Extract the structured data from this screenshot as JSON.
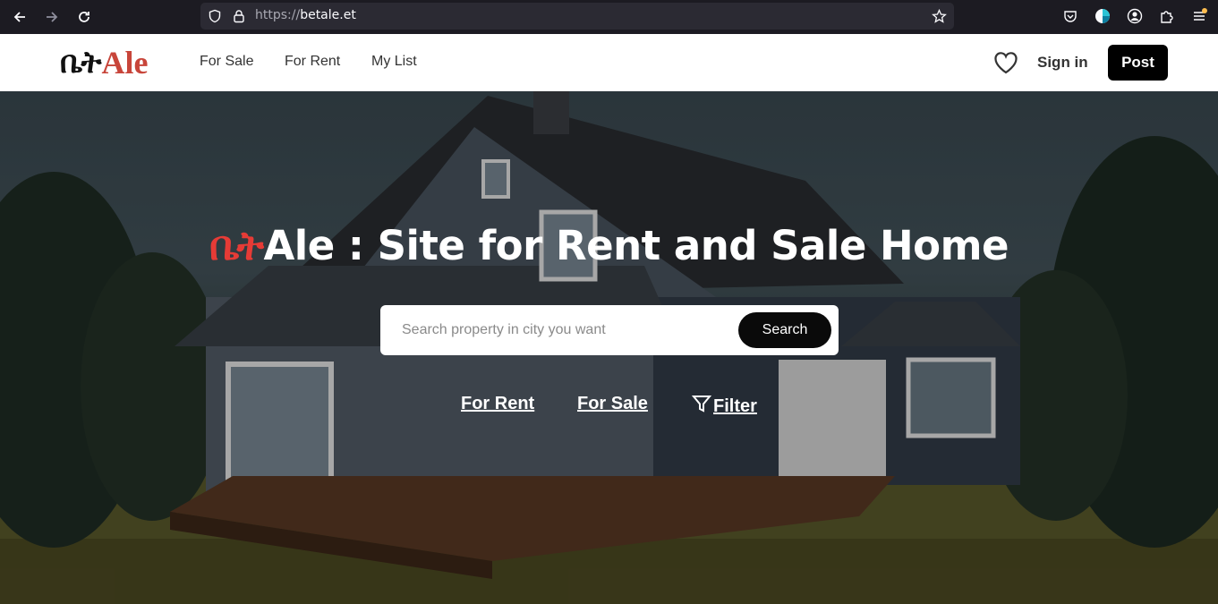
{
  "browser": {
    "url_protocol": "https://",
    "url_host": "betale.et"
  },
  "header": {
    "logo_amharic": "ቤት",
    "logo_latin": "Ale",
    "nav": [
      "For Sale",
      "For Rent",
      "My List"
    ],
    "sign_in": "Sign in",
    "post": "Post"
  },
  "hero": {
    "title_amharic": "ቤት",
    "title_rest": "Ale : Site for Rent and Sale Home",
    "search_placeholder": "Search property in city you want",
    "search_button": "Search",
    "links": [
      "For Rent",
      "For Sale",
      "Filter"
    ]
  },
  "colors": {
    "brand_red": "#e63b36",
    "logo_red": "#c8453a",
    "button_black": "#000000"
  }
}
